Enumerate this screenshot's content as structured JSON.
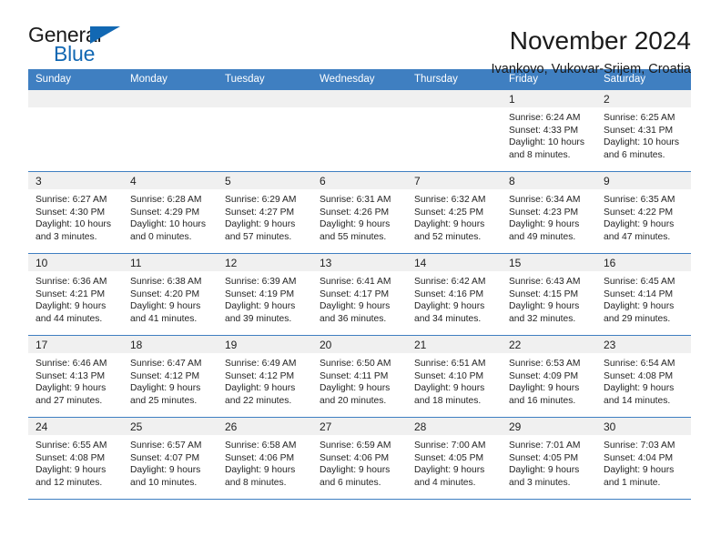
{
  "brand": {
    "name_dark": "General",
    "name_blue": "Blue",
    "accent_color": "#1268b3"
  },
  "header": {
    "title": "November 2024",
    "subtitle": "Ivankovo, Vukovar-Srijem, Croatia"
  },
  "calendar": {
    "header_bg": "#3f7fc1",
    "daynum_bg": "#f0f0f0",
    "weekdays": [
      "Sunday",
      "Monday",
      "Tuesday",
      "Wednesday",
      "Thursday",
      "Friday",
      "Saturday"
    ],
    "weeks": [
      [
        {
          "day": "",
          "text": ""
        },
        {
          "day": "",
          "text": ""
        },
        {
          "day": "",
          "text": ""
        },
        {
          "day": "",
          "text": ""
        },
        {
          "day": "",
          "text": ""
        },
        {
          "day": "1",
          "text": "Sunrise: 6:24 AM\nSunset: 4:33 PM\nDaylight: 10 hours\nand 8 minutes."
        },
        {
          "day": "2",
          "text": "Sunrise: 6:25 AM\nSunset: 4:31 PM\nDaylight: 10 hours\nand 6 minutes."
        }
      ],
      [
        {
          "day": "3",
          "text": "Sunrise: 6:27 AM\nSunset: 4:30 PM\nDaylight: 10 hours\nand 3 minutes."
        },
        {
          "day": "4",
          "text": "Sunrise: 6:28 AM\nSunset: 4:29 PM\nDaylight: 10 hours\nand 0 minutes."
        },
        {
          "day": "5",
          "text": "Sunrise: 6:29 AM\nSunset: 4:27 PM\nDaylight: 9 hours\nand 57 minutes."
        },
        {
          "day": "6",
          "text": "Sunrise: 6:31 AM\nSunset: 4:26 PM\nDaylight: 9 hours\nand 55 minutes."
        },
        {
          "day": "7",
          "text": "Sunrise: 6:32 AM\nSunset: 4:25 PM\nDaylight: 9 hours\nand 52 minutes."
        },
        {
          "day": "8",
          "text": "Sunrise: 6:34 AM\nSunset: 4:23 PM\nDaylight: 9 hours\nand 49 minutes."
        },
        {
          "day": "9",
          "text": "Sunrise: 6:35 AM\nSunset: 4:22 PM\nDaylight: 9 hours\nand 47 minutes."
        }
      ],
      [
        {
          "day": "10",
          "text": "Sunrise: 6:36 AM\nSunset: 4:21 PM\nDaylight: 9 hours\nand 44 minutes."
        },
        {
          "day": "11",
          "text": "Sunrise: 6:38 AM\nSunset: 4:20 PM\nDaylight: 9 hours\nand 41 minutes."
        },
        {
          "day": "12",
          "text": "Sunrise: 6:39 AM\nSunset: 4:19 PM\nDaylight: 9 hours\nand 39 minutes."
        },
        {
          "day": "13",
          "text": "Sunrise: 6:41 AM\nSunset: 4:17 PM\nDaylight: 9 hours\nand 36 minutes."
        },
        {
          "day": "14",
          "text": "Sunrise: 6:42 AM\nSunset: 4:16 PM\nDaylight: 9 hours\nand 34 minutes."
        },
        {
          "day": "15",
          "text": "Sunrise: 6:43 AM\nSunset: 4:15 PM\nDaylight: 9 hours\nand 32 minutes."
        },
        {
          "day": "16",
          "text": "Sunrise: 6:45 AM\nSunset: 4:14 PM\nDaylight: 9 hours\nand 29 minutes."
        }
      ],
      [
        {
          "day": "17",
          "text": "Sunrise: 6:46 AM\nSunset: 4:13 PM\nDaylight: 9 hours\nand 27 minutes."
        },
        {
          "day": "18",
          "text": "Sunrise: 6:47 AM\nSunset: 4:12 PM\nDaylight: 9 hours\nand 25 minutes."
        },
        {
          "day": "19",
          "text": "Sunrise: 6:49 AM\nSunset: 4:12 PM\nDaylight: 9 hours\nand 22 minutes."
        },
        {
          "day": "20",
          "text": "Sunrise: 6:50 AM\nSunset: 4:11 PM\nDaylight: 9 hours\nand 20 minutes."
        },
        {
          "day": "21",
          "text": "Sunrise: 6:51 AM\nSunset: 4:10 PM\nDaylight: 9 hours\nand 18 minutes."
        },
        {
          "day": "22",
          "text": "Sunrise: 6:53 AM\nSunset: 4:09 PM\nDaylight: 9 hours\nand 16 minutes."
        },
        {
          "day": "23",
          "text": "Sunrise: 6:54 AM\nSunset: 4:08 PM\nDaylight: 9 hours\nand 14 minutes."
        }
      ],
      [
        {
          "day": "24",
          "text": "Sunrise: 6:55 AM\nSunset: 4:08 PM\nDaylight: 9 hours\nand 12 minutes."
        },
        {
          "day": "25",
          "text": "Sunrise: 6:57 AM\nSunset: 4:07 PM\nDaylight: 9 hours\nand 10 minutes."
        },
        {
          "day": "26",
          "text": "Sunrise: 6:58 AM\nSunset: 4:06 PM\nDaylight: 9 hours\nand 8 minutes."
        },
        {
          "day": "27",
          "text": "Sunrise: 6:59 AM\nSunset: 4:06 PM\nDaylight: 9 hours\nand 6 minutes."
        },
        {
          "day": "28",
          "text": "Sunrise: 7:00 AM\nSunset: 4:05 PM\nDaylight: 9 hours\nand 4 minutes."
        },
        {
          "day": "29",
          "text": "Sunrise: 7:01 AM\nSunset: 4:05 PM\nDaylight: 9 hours\nand 3 minutes."
        },
        {
          "day": "30",
          "text": "Sunrise: 7:03 AM\nSunset: 4:04 PM\nDaylight: 9 hours\nand 1 minute."
        }
      ]
    ]
  }
}
